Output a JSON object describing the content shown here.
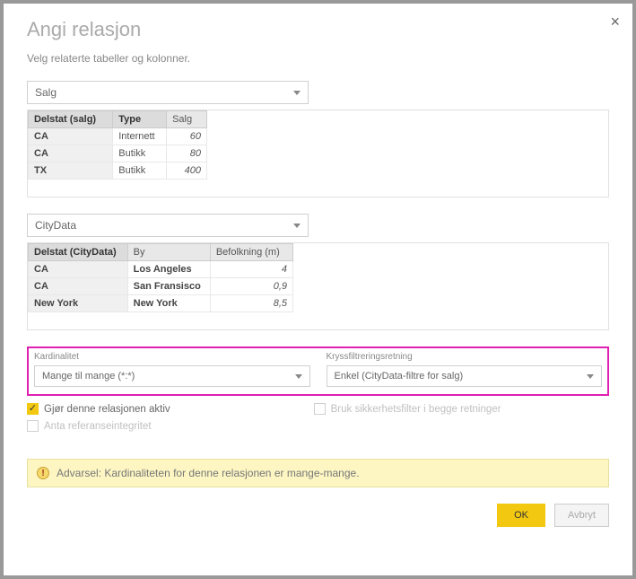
{
  "title": "Angi relasjon",
  "subtitle": "Velg relaterte tabeller og kolonner.",
  "select1": "Salg",
  "table1": {
    "headers": [
      "Delstat (salg)",
      "Type",
      "Salg"
    ],
    "rows": [
      {
        "state": "CA",
        "type": "Internett",
        "value": "60"
      },
      {
        "state": "CA",
        "type": "Butikk",
        "value": "80"
      },
      {
        "state": "TX",
        "type": "Butikk",
        "value": "400"
      }
    ]
  },
  "select2": "CityData",
  "table2": {
    "headers": [
      "Delstat (CityData)",
      "By",
      "Befolkning (m)"
    ],
    "rows": [
      {
        "state": "CA",
        "city": "Los Angeles",
        "value": "4"
      },
      {
        "state": "CA",
        "city": "San Fransisco",
        "value": "0,9"
      },
      {
        "state": "New York",
        "city": "New York",
        "value": "8,5"
      }
    ]
  },
  "cardinality": {
    "label": "Kardinalitet",
    "value": "Mange til mange (*:*)"
  },
  "crossfilter": {
    "label": "Kryssfiltreringsretning",
    "value": "Enkel (CityData-filtre for salg)"
  },
  "check_active": "Gjør denne relasjonen aktiv",
  "check_secfilter": "Bruk sikkerhetsfilter i begge retninger",
  "check_refint": "Anta referanseintegritet",
  "warning": "Advarsel: Kardinaliteten for denne relasjonen er mange-mange.",
  "ok": "OK",
  "cancel": "Avbryt"
}
